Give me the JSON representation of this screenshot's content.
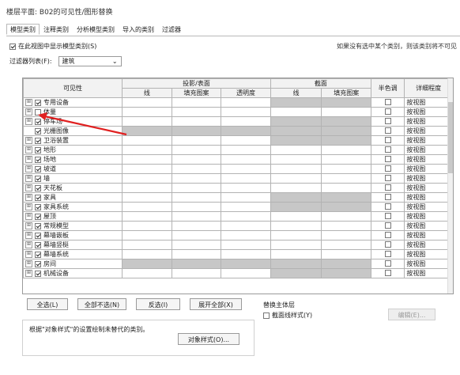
{
  "title": "楼层平面: B02的可见性/图形替换",
  "tabs": [
    "模型类别",
    "注释类别",
    "分析模型类别",
    "导入的类别",
    "过滤器"
  ],
  "show_model_label": "在此视图中显示模型类别(S)",
  "note": "如果没有选中某个类别，则该类别将不可见",
  "filter_label": "过滤器列表(F):",
  "filter_value": "建筑",
  "columns": {
    "visibility": "可见性",
    "proj_group": "投影/表面",
    "cut_group": "截面",
    "line": "线",
    "fill": "填充图案",
    "transparency": "透明度",
    "halftone": "半色调",
    "detail": "详细程度"
  },
  "rows": [
    {
      "name": "专用设备",
      "expand": "⊞",
      "checked": true,
      "cut_gray": true,
      "halftone": true,
      "detail": "按视图"
    },
    {
      "name": "体量",
      "expand": "⊞",
      "checked": false,
      "cut_gray": false,
      "halftone": true,
      "detail": "按视图"
    },
    {
      "name": "停车场",
      "expand": "⊞",
      "checked": true,
      "cut_gray": true,
      "halftone": true,
      "detail": "按视图"
    },
    {
      "name": "光栅图像",
      "expand": "",
      "checked": true,
      "proj_gray": true,
      "cut_gray": true,
      "halftone": true,
      "detail": "按视图"
    },
    {
      "name": "卫浴装置",
      "expand": "⊞",
      "checked": true,
      "cut_gray": true,
      "halftone": true,
      "detail": "按视图"
    },
    {
      "name": "地形",
      "expand": "⊞",
      "checked": true,
      "cut_gray": false,
      "halftone": true,
      "detail": "按视图"
    },
    {
      "name": "场地",
      "expand": "⊞",
      "checked": true,
      "cut_gray": false,
      "halftone": true,
      "detail": "按视图"
    },
    {
      "name": "坡道",
      "expand": "⊞",
      "checked": true,
      "cut_gray": false,
      "halftone": true,
      "detail": "按视图"
    },
    {
      "name": "墙",
      "expand": "⊞",
      "checked": true,
      "cut_gray": false,
      "halftone": true,
      "detail": "按视图"
    },
    {
      "name": "天花板",
      "expand": "⊞",
      "checked": true,
      "cut_gray": false,
      "halftone": true,
      "detail": "按视图"
    },
    {
      "name": "家具",
      "expand": "⊞",
      "checked": true,
      "cut_gray": true,
      "halftone": true,
      "detail": "按视图"
    },
    {
      "name": "家具系统",
      "expand": "⊞",
      "checked": true,
      "cut_gray": true,
      "halftone": true,
      "detail": "按视图"
    },
    {
      "name": "屋顶",
      "expand": "⊞",
      "checked": true,
      "cut_gray": false,
      "halftone": true,
      "detail": "按视图"
    },
    {
      "name": "常规模型",
      "expand": "⊞",
      "checked": true,
      "cut_gray": false,
      "halftone": true,
      "detail": "按视图"
    },
    {
      "name": "幕墙嵌板",
      "expand": "⊞",
      "checked": true,
      "cut_gray": false,
      "halftone": true,
      "detail": "按视图"
    },
    {
      "name": "幕墙竖梃",
      "expand": "⊞",
      "checked": true,
      "cut_gray": false,
      "halftone": true,
      "detail": "按视图"
    },
    {
      "name": "幕墙系统",
      "expand": "⊞",
      "checked": true,
      "cut_gray": false,
      "halftone": true,
      "detail": "按视图"
    },
    {
      "name": "房间",
      "expand": "⊞",
      "checked": true,
      "proj_gray": true,
      "cut_gray": true,
      "halftone": true,
      "detail": "按视图"
    },
    {
      "name": "机械设备",
      "expand": "⊞",
      "checked": true,
      "cut_gray": true,
      "halftone": true,
      "detail": "按视图"
    }
  ],
  "buttons": {
    "select_all": "全选(L)",
    "select_none": "全部不选(N)",
    "invert": "反选(I)",
    "expand_all": "展开全部(X)",
    "object_styles": "对象样式(O)...",
    "edit": "编辑(E)..."
  },
  "override_group": "替换主体层",
  "override_check": "截面线样式(Y)",
  "info_text": "根据\"对象样式\"的设置绘制未替代的类别。"
}
